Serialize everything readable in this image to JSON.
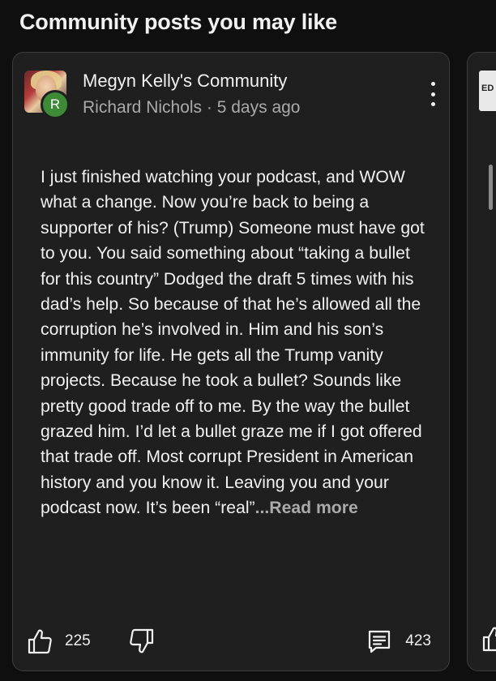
{
  "section": {
    "title": "Community posts you may like"
  },
  "post": {
    "community_name": "Megyn Kelly's Community",
    "author": "Richard Nichols",
    "separator": " · ",
    "time_ago": "5 days ago",
    "badge_letter": "R",
    "badge_color": "#3d8b37",
    "body": "I just finished watching your podcast, and WOW what a change. Now you’re back to being a supporter of his? (Trump) Someone must have got to you. You said something about “taking a bullet for this country” Dodged the draft 5 times with his dad’s help. So because of that he’s allowed all the corruption he’s involved in. Him and his son’s immunity for life. He gets all the Trump vanity projects. Because he took a bullet? Sounds like pretty good trade off to me. By the way the bullet grazed him. I’d let a bullet graze me if I got offered that trade off. Most corrupt President in American history and you know it. Leaving you and your podcast now. It’s been “real”",
    "read_more": "...Read more",
    "likes": "225",
    "comments": "423",
    "icons": {
      "like": "thumbs-up-icon",
      "dislike": "thumbs-down-icon",
      "comment": "comment-icon",
      "menu": "more-vert-icon"
    }
  },
  "next_card": {
    "thumb_text": "ED"
  }
}
